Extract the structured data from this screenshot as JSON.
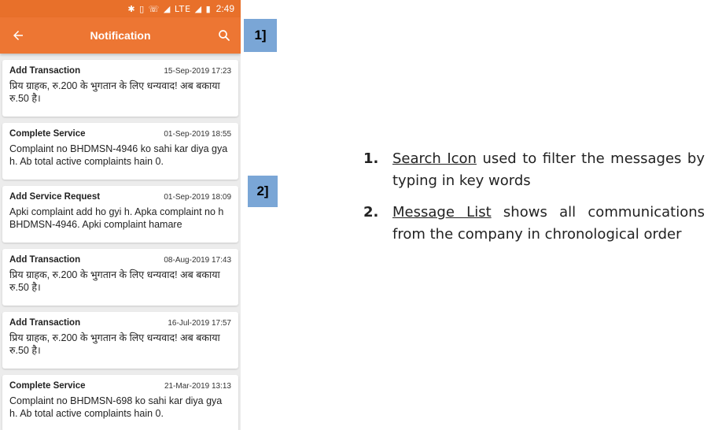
{
  "status_bar": {
    "time": "2:49",
    "icons": "✱ ▯ ☏ ◢ LTE ◢ ▮"
  },
  "app_bar": {
    "title": "Notification"
  },
  "notifications": [
    {
      "title": "Add Transaction",
      "date": "15-Sep-2019 17:23",
      "body": "प्रिय ग्राहक, रु.200 के भुगतान के लिए धन्यवाद! अब बकाया रु.50 है।"
    },
    {
      "title": "Complete Service",
      "date": "01-Sep-2019 18:55",
      "body": "Complaint no BHDMSN-4946 ko sahi kar diya gya h. Ab total active complaints hain 0."
    },
    {
      "title": "Add Service Request",
      "date": "01-Sep-2019 18:09",
      "body": "Apki complaint add ho gyi h. Apka complaint no h BHDMSN-4946. Apki complaint hamare"
    },
    {
      "title": "Add Transaction",
      "date": "08-Aug-2019 17:43",
      "body": "प्रिय ग्राहक, रु.200 के भुगतान के लिए धन्यवाद! अब बकाया रु.50 है।"
    },
    {
      "title": "Add Transaction",
      "date": "16-Jul-2019 17:57",
      "body": "प्रिय ग्राहक, रु.200 के भुगतान के लिए धन्यवाद! अब बकाया रु.50 है।"
    },
    {
      "title": "Complete Service",
      "date": "21-Mar-2019 13:13",
      "body": "Complaint no BHDMSN-698 ko sahi kar diya gya h. Ab total active complaints hain 0."
    }
  ],
  "callouts": {
    "one": "1]",
    "two": "2]"
  },
  "description": [
    {
      "num": "1.",
      "key": "Search Icon",
      "rest": " used to filter the messages by typing in key words"
    },
    {
      "num": "2.",
      "key": "Message List",
      "rest": " shows all communications from the company in chronological order"
    }
  ],
  "colors": {
    "app_bar": "#ed7633",
    "status_bar": "#e8702a",
    "callout": "#7aa6d6",
    "list_bg": "#ececec"
  }
}
